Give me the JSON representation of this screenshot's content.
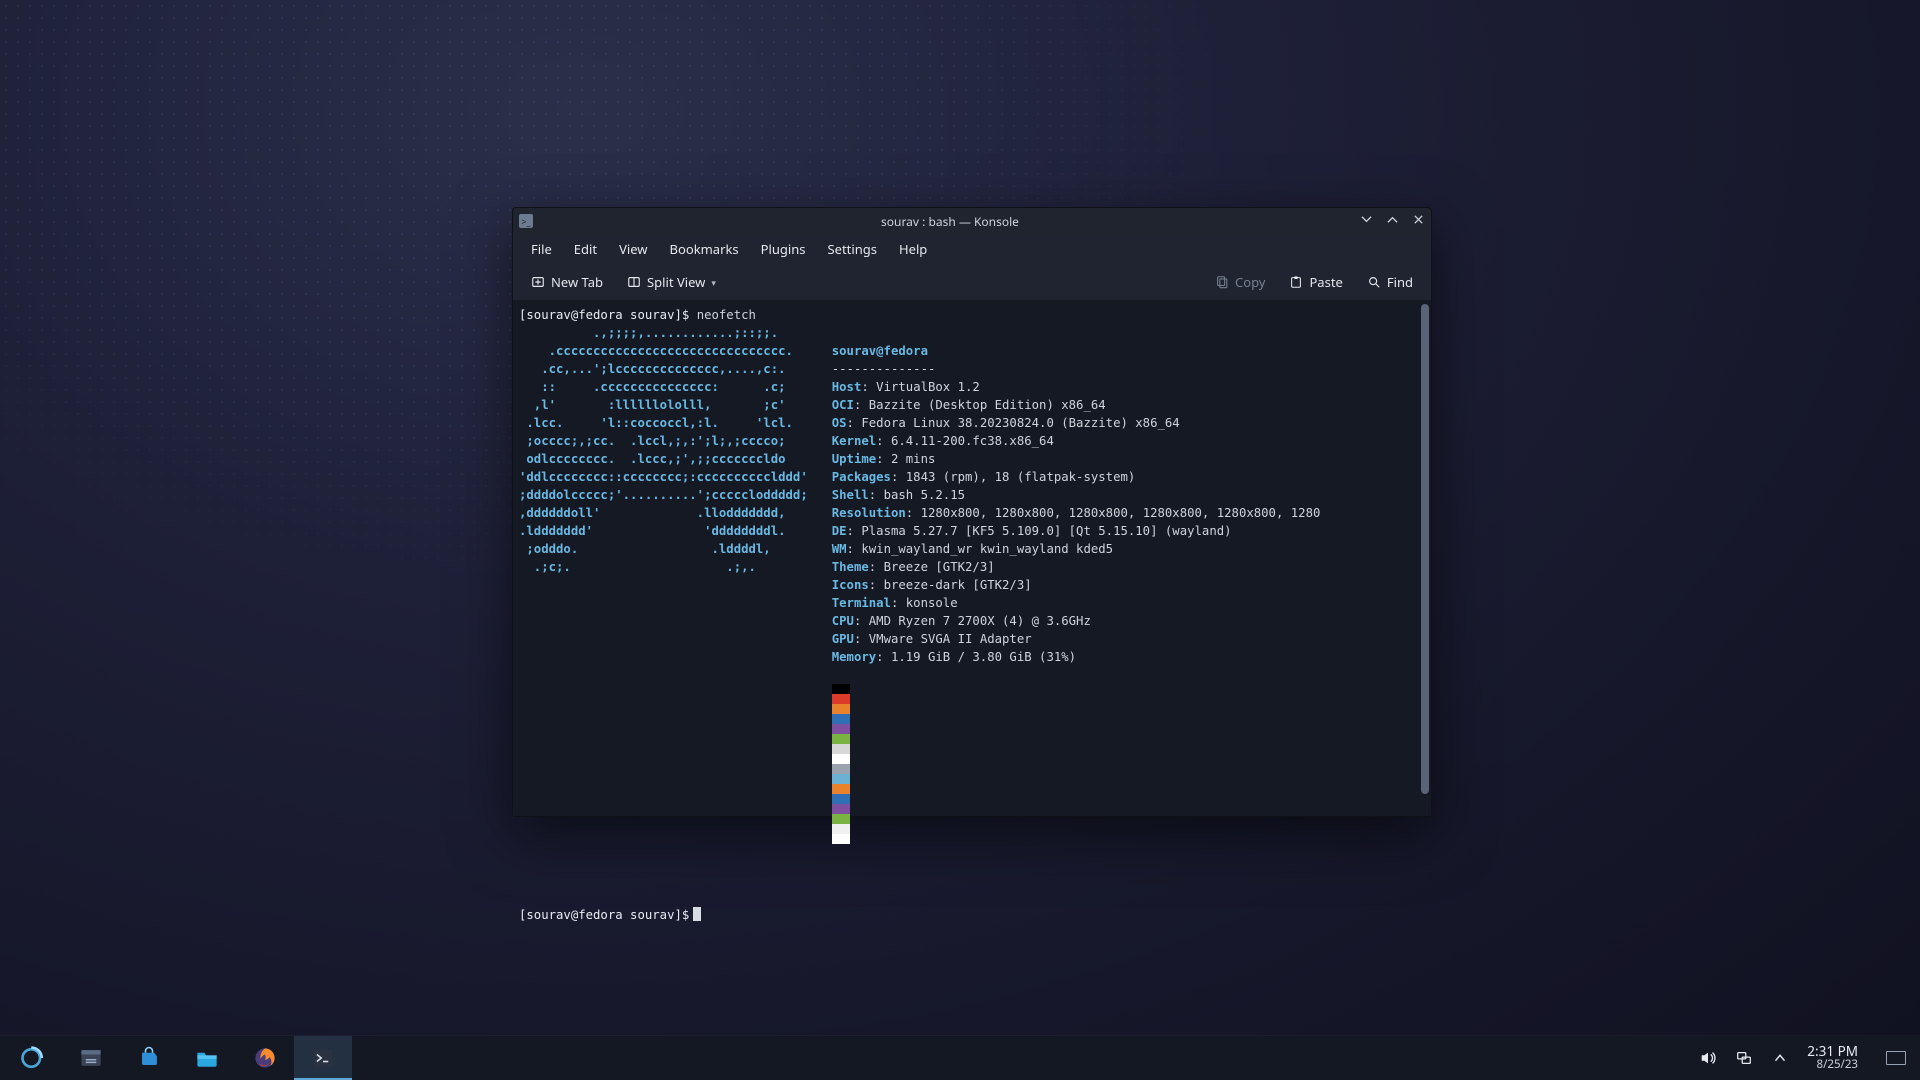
{
  "window": {
    "title": "sourav : bash — Konsole",
    "menus": [
      "File",
      "Edit",
      "View",
      "Bookmarks",
      "Plugins",
      "Settings",
      "Help"
    ],
    "toolbar": {
      "new_tab": "New Tab",
      "split_view": "Split View",
      "copy": "Copy",
      "paste": "Paste",
      "find": "Find"
    }
  },
  "terminal": {
    "prompt": "[sourav@fedora sourav]$ ",
    "command": "neofetch",
    "ascii": "          .,;;;;,............;::;;.\n    .ccccccccccccccccccccccccccccccc.\n   .cc,...';lcccccccccccccc,....,c:.\n   ::     .ccccccccccccccc:      .c;\n  ,l'       :llllllololll,       ;c'\n .lcc.     'l::coccoccl,:l.     'lcl.\n ;occcc;,;cc.  .lccl,;,:';l;,;cccco;\n odlcccccccc.  .lccc,;',;;cccccccldo\n'ddlcccccccc::cccccccc;:cccccccccclddd'\n;ddddolccccc;'..........';cccccloddddd;\n,ddddddoll'             .lloddddddd,\n.lddddddd'               'ddddddddl.\n ;odddo.                  .lddddl,\n  .;c;.                     .;,.",
    "userhost": "sourav@fedora",
    "divider": "--------------",
    "fields": [
      {
        "k": "Host",
        "v": "VirtualBox 1.2"
      },
      {
        "k": "OCI",
        "v": "Bazzite (Desktop Edition) x86_64"
      },
      {
        "k": "OS",
        "v": "Fedora Linux 38.20230824.0 (Bazzite) x86_64"
      },
      {
        "k": "Kernel",
        "v": "6.4.11-200.fc38.x86_64"
      },
      {
        "k": "Uptime",
        "v": "2 mins"
      },
      {
        "k": "Packages",
        "v": "1843 (rpm), 18 (flatpak-system)"
      },
      {
        "k": "Shell",
        "v": "bash 5.2.15"
      },
      {
        "k": "Resolution",
        "v": "1280x800, 1280x800, 1280x800, 1280x800, 1280x800, 1280"
      },
      {
        "k": "DE",
        "v": "Plasma 5.27.7 [KF5 5.109.0] [Qt 5.15.10] (wayland)"
      },
      {
        "k": "WM",
        "v": "kwin_wayland_wr kwin_wayland kded5"
      },
      {
        "k": "Theme",
        "v": "Breeze [GTK2/3]"
      },
      {
        "k": "Icons",
        "v": "breeze-dark [GTK2/3]"
      },
      {
        "k": "Terminal",
        "v": "konsole"
      },
      {
        "k": "CPU",
        "v": "AMD Ryzen 7 2700X (4) @ 3.6GHz"
      },
      {
        "k": "GPU",
        "v": "VMware SVGA II Adapter"
      },
      {
        "k": "Memory",
        "v": "1.19 GiB / 3.80 GiB (31%)"
      }
    ],
    "palette_top": [
      "#000000",
      "#dd3b2a",
      "#e9822c",
      "#2f6fb6",
      "#7c4fa0",
      "#7bb342",
      "#d7d7d7",
      "#ffffff"
    ],
    "palette_bottom": [
      "#9aa3af",
      "#6bb1d3",
      "#e9822c",
      "#2f6fb6",
      "#7c4fa0",
      "#7bb342",
      "#f0f0f0",
      "#ffffff"
    ],
    "second_prompt": "[sourav@fedora sourav]$"
  },
  "taskbar": {
    "time": "2:31 PM",
    "date": "8/25/23"
  }
}
